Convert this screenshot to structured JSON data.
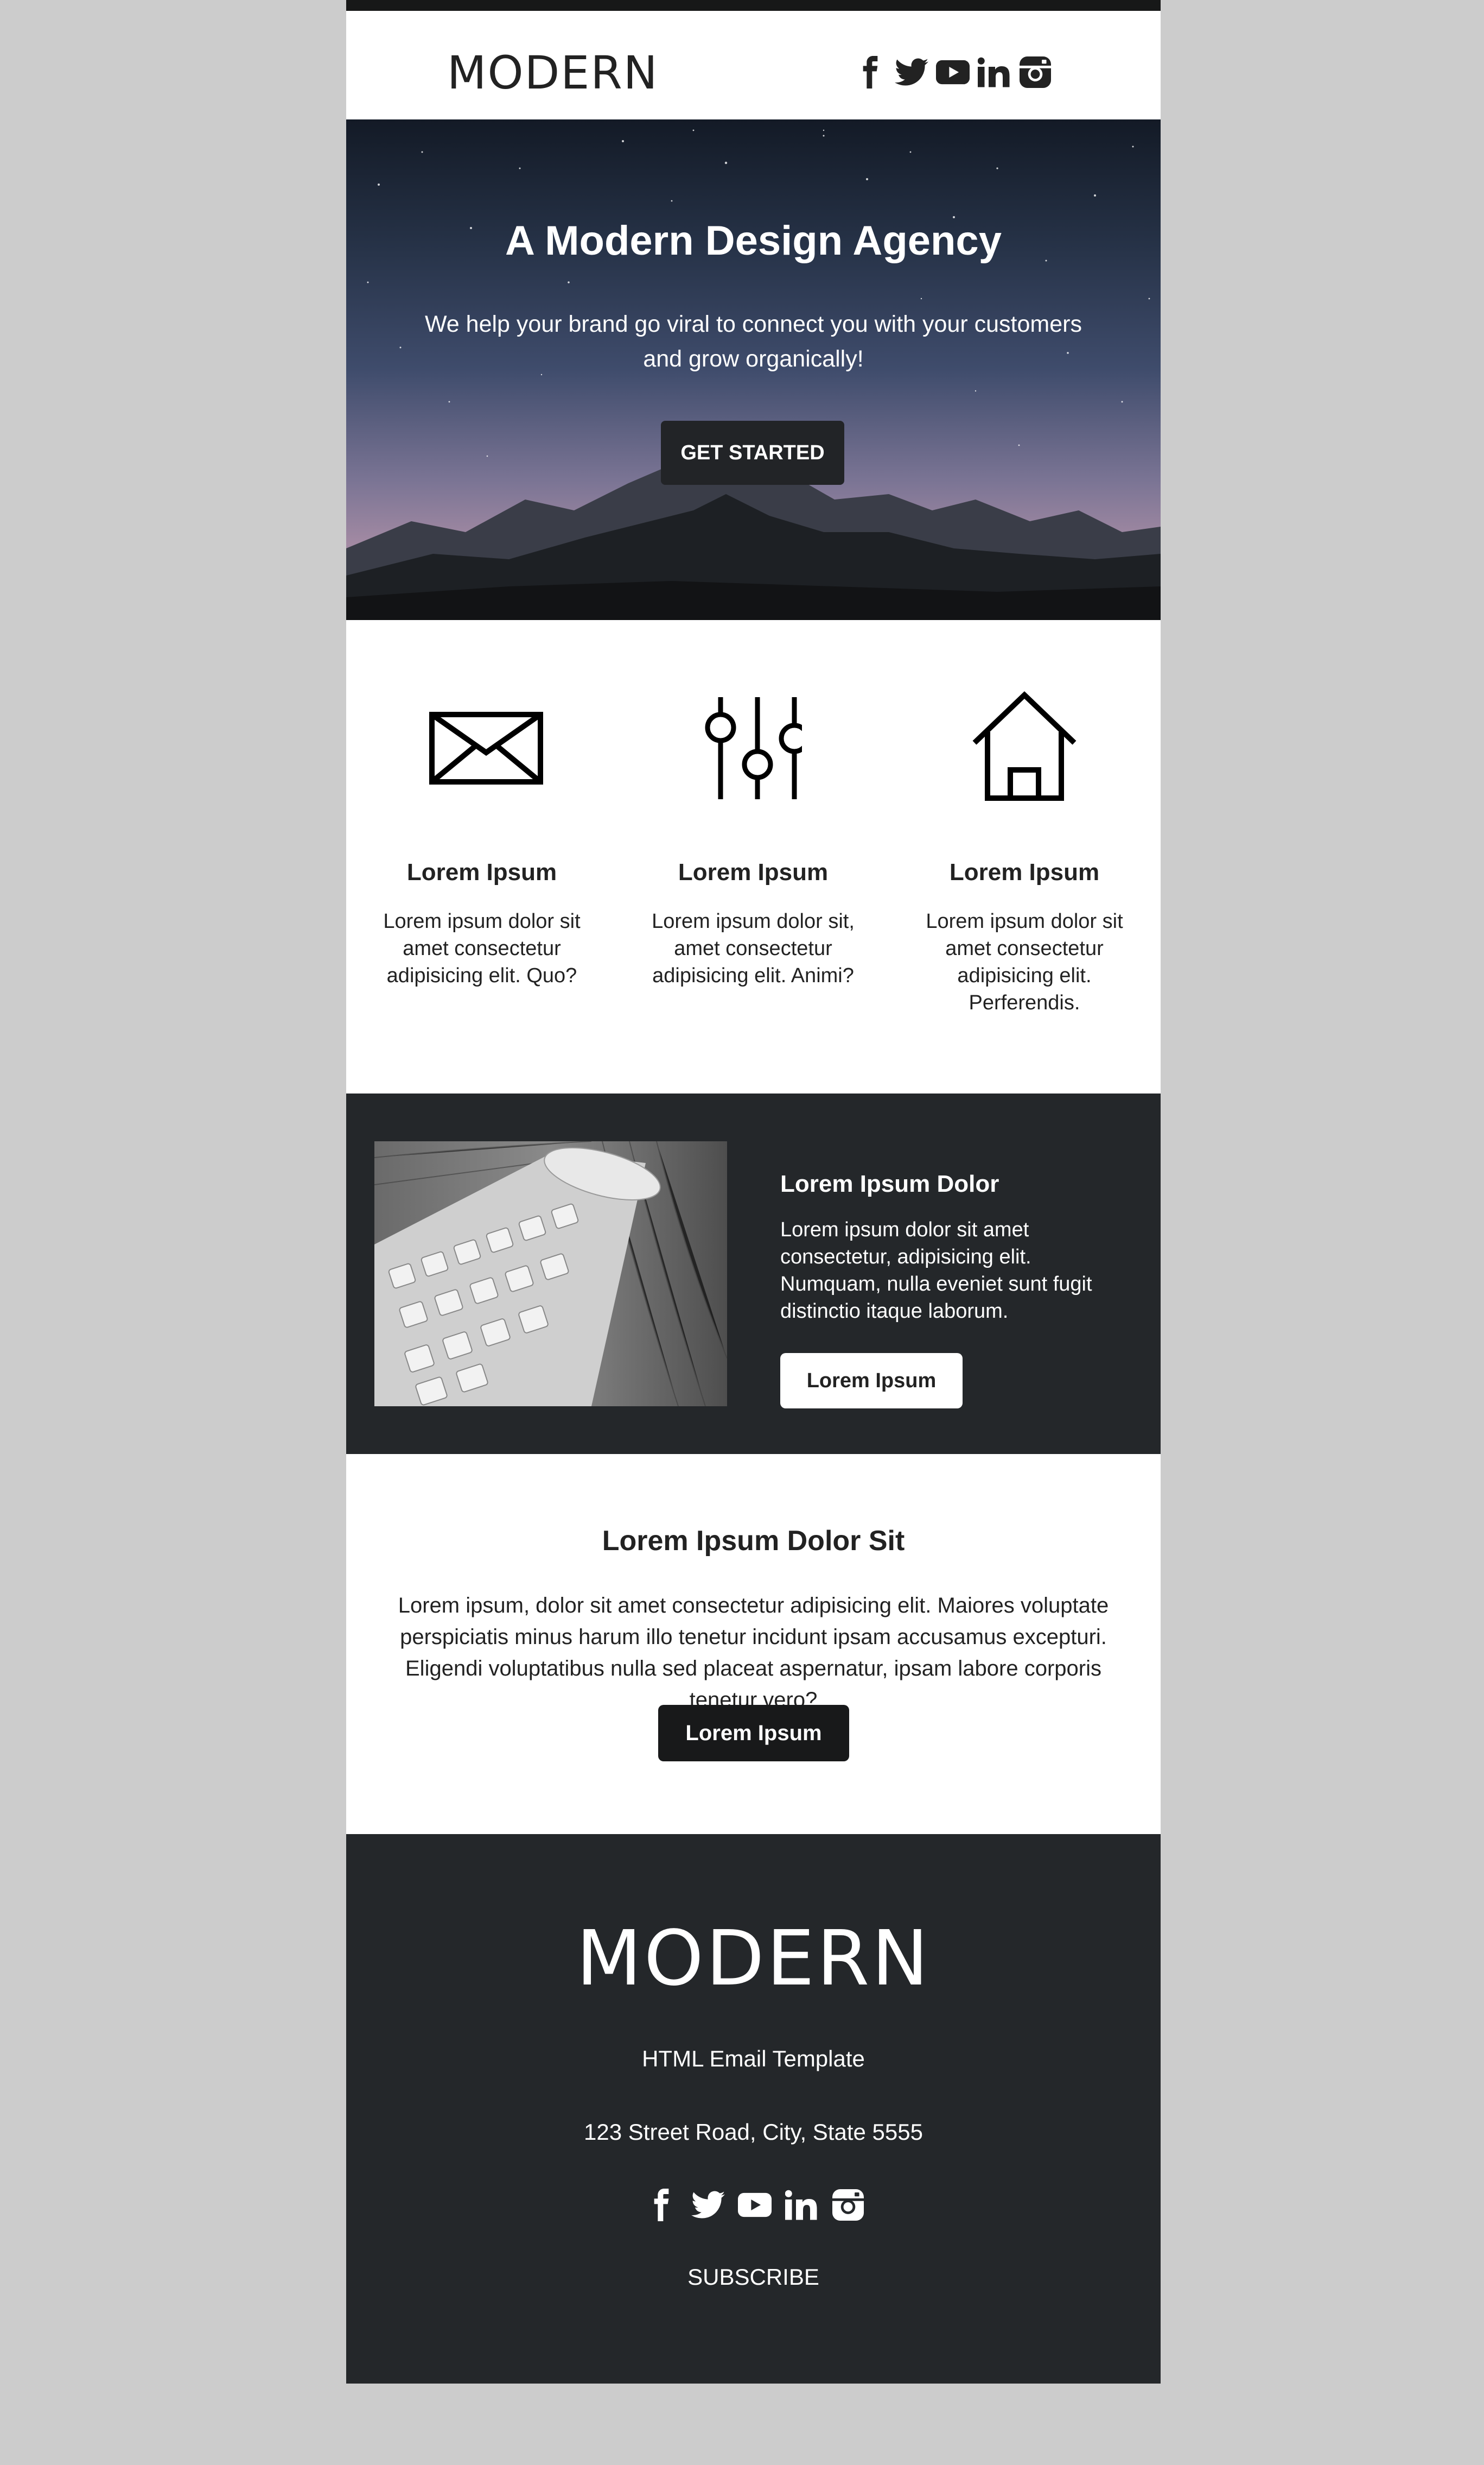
{
  "header": {
    "logo": "MODERN",
    "social": [
      "facebook-icon",
      "twitter-icon",
      "youtube-icon",
      "linkedin-icon",
      "instagram-icon"
    ]
  },
  "hero": {
    "title": "A Modern Design Agency",
    "subtitle": "We help your brand go viral to connect you with your customers and grow organically!",
    "button_label": "GET STARTED"
  },
  "features": [
    {
      "icon": "envelope-icon",
      "title": "Lorem Ipsum",
      "text": "Lorem ipsum dolor sit amet consectetur adipisicing elit. Quo?"
    },
    {
      "icon": "sliders-icon",
      "title": "Lorem Ipsum",
      "text": "Lorem ipsum dolor sit, amet consectetur adipisicing elit. Animi?"
    },
    {
      "icon": "home-icon",
      "title": "Lorem Ipsum",
      "text": "Lorem ipsum dolor sit amet consectetur adipisicing elit. Perferendis."
    }
  ],
  "promo": {
    "image": "keyboard-and-mouse-photo",
    "title": "Lorem Ipsum Dolor",
    "text": "Lorem ipsum dolor sit amet consectetur, adipisicing elit. Numquam, nulla eveniet sunt fugit distinctio itaque laborum.",
    "button_label": "Lorem Ipsum"
  },
  "cta": {
    "title": "Lorem Ipsum Dolor Sit",
    "text": "Lorem ipsum, dolor sit amet consectetur adipisicing elit. Maiores voluptate perspiciatis minus harum illo tenetur incidunt ipsam accusamus excepturi. Eligendi voluptatibus nulla sed placeat aspernatur, ipsam labore corporis tenetur vero?",
    "button_label": "Lorem Ipsum"
  },
  "footer": {
    "logo": "MODERN",
    "tagline": "HTML Email Template",
    "address": "123 Street Road, City, State 5555",
    "social": [
      "facebook-icon",
      "twitter-icon",
      "youtube-icon",
      "linkedin-icon",
      "instagram-icon"
    ],
    "subscribe_label": "SUBSCRIBE"
  },
  "colors": {
    "page_background": "#cccccc",
    "dark": "#24272a",
    "button_dark": "#18191a",
    "white": "#ffffff"
  }
}
